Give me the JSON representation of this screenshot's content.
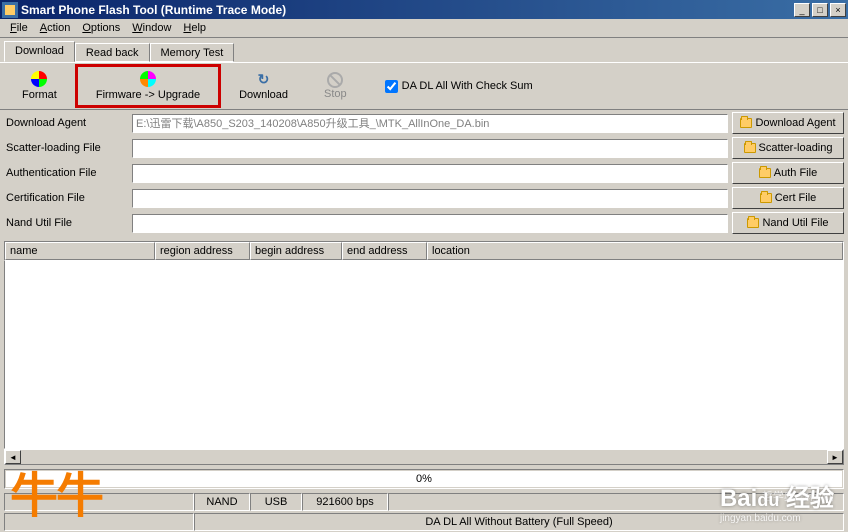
{
  "window": {
    "title": "Smart Phone Flash Tool (Runtime Trace Mode)"
  },
  "menu": {
    "file": "File",
    "action": "Action",
    "options": "Options",
    "window": "Window",
    "help": "Help"
  },
  "tabs": {
    "download": "Download",
    "readback": "Read back",
    "memtest": "Memory Test"
  },
  "toolbar": {
    "format": "Format",
    "firmware_upgrade": "Firmware -> Upgrade",
    "download": "Download",
    "stop": "Stop",
    "checkbox_label": "DA DL All With Check Sum",
    "checkbox_checked": true
  },
  "form": {
    "download_agent_label": "Download Agent",
    "download_agent_value": "E:\\迅雷下载\\A850_S203_140208\\A850升级工具_\\MTK_AllInOne_DA.bin",
    "scatter_loading_label": "Scatter-loading File",
    "scatter_loading_value": "",
    "authentication_label": "Authentication File",
    "authentication_value": "",
    "certification_label": "Certification File",
    "certification_value": "",
    "nand_util_label": "Nand Util File",
    "nand_util_value": ""
  },
  "buttons": {
    "download_agent": "Download Agent",
    "scatter_loading": "Scatter-loading",
    "auth_file": "Auth File",
    "cert_file": "Cert File",
    "nand_util_file": "Nand Util File"
  },
  "table": {
    "col_name": "name",
    "col_region": "region address",
    "col_begin": "begin address",
    "col_end": "end address",
    "col_location": "location"
  },
  "progress": {
    "text": "0%"
  },
  "status": {
    "cell1": "",
    "cell2": "NAND",
    "cell3": "USB",
    "cell4": "921600 bps",
    "cell5": "",
    "line2": "DA DL All Without Battery (Full Speed)"
  },
  "watermarks": {
    "left": "牛牛",
    "right_top": "哲学典 教程 网",
    "right_main": "Baidu 经验",
    "right_sub": "jingyan.baidu.com"
  }
}
